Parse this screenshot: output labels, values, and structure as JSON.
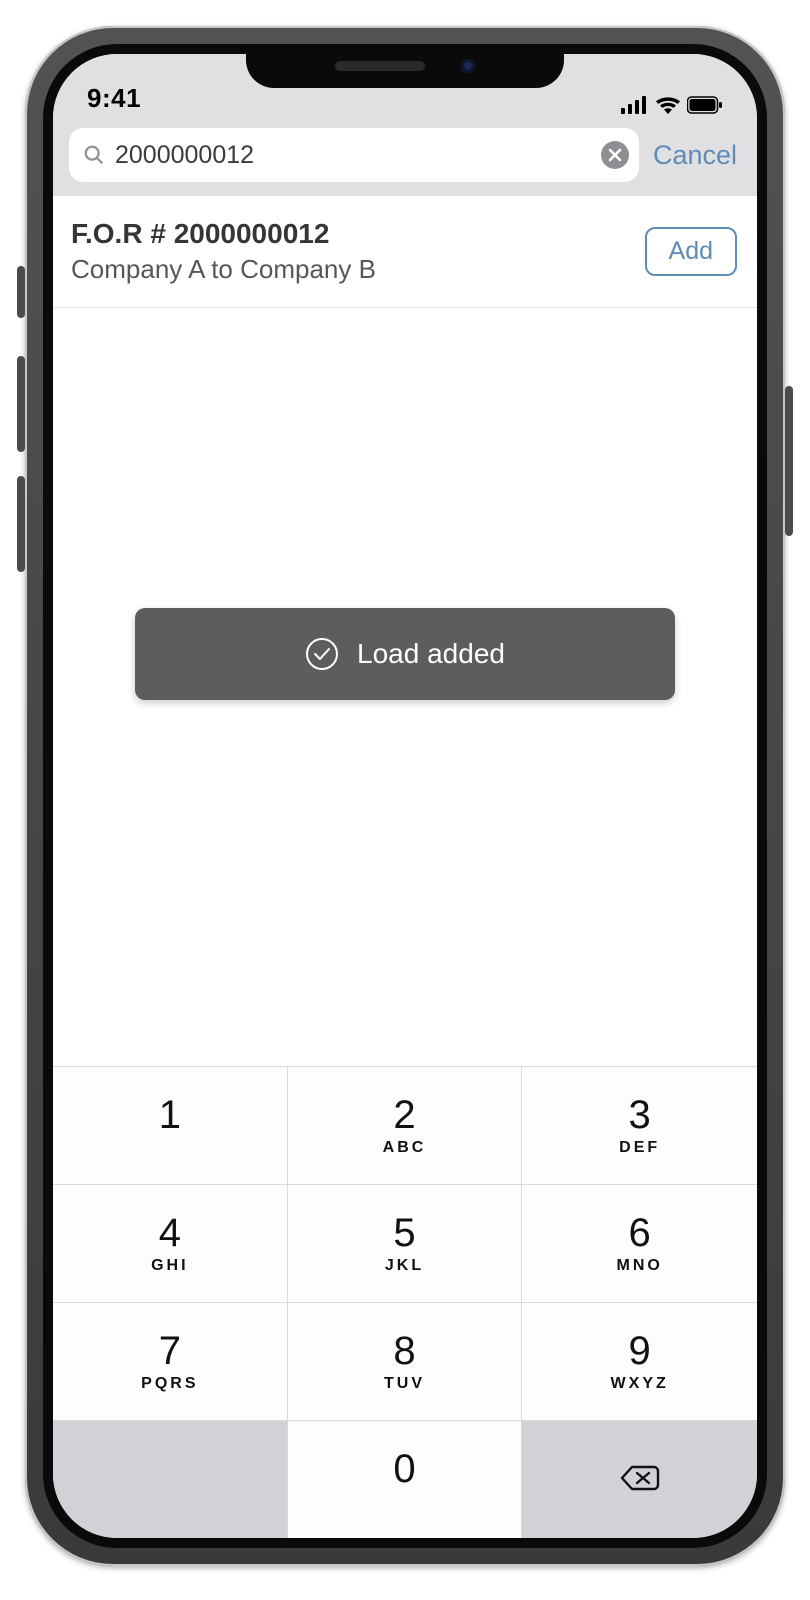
{
  "status": {
    "time": "9:41"
  },
  "search": {
    "value": "2000000012",
    "cancel": "Cancel"
  },
  "result": {
    "title": "F.O.R # 2000000012",
    "subtitle": "Company A to Company B",
    "add": "Add"
  },
  "toast": {
    "message": "Load added"
  },
  "keypad": {
    "keys": [
      {
        "digit": "1",
        "letters": ""
      },
      {
        "digit": "2",
        "letters": "ABC"
      },
      {
        "digit": "3",
        "letters": "DEF"
      },
      {
        "digit": "4",
        "letters": "GHI"
      },
      {
        "digit": "5",
        "letters": "JKL"
      },
      {
        "digit": "6",
        "letters": "MNO"
      },
      {
        "digit": "7",
        "letters": "PQRS"
      },
      {
        "digit": "8",
        "letters": "TUV"
      },
      {
        "digit": "9",
        "letters": "WXYZ"
      }
    ],
    "zero": "0"
  }
}
